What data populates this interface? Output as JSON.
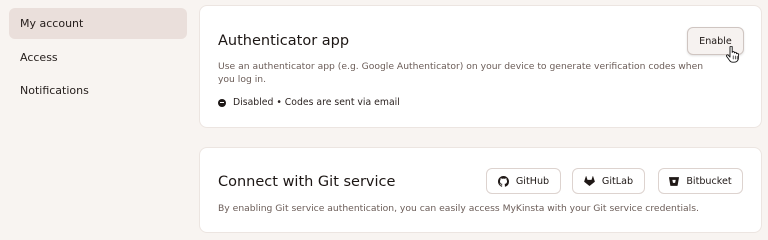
{
  "sidebar": {
    "items": [
      {
        "label": "My account",
        "active": true
      },
      {
        "label": "Access",
        "active": false
      },
      {
        "label": "Notifications",
        "active": false
      }
    ]
  },
  "authenticator": {
    "title": "Authenticator app",
    "description": "Use an authenticator app (e.g. Google Authenticator) on your device to generate verification codes when you log in.",
    "status": "Disabled • Codes are sent via email",
    "enable_label": "Enable"
  },
  "git": {
    "title": "Connect with Git service",
    "description": "By enabling Git service authentication, you can easily access MyKinsta with your Git service credentials.",
    "buttons": [
      {
        "label": "GitHub",
        "icon": "github-icon"
      },
      {
        "label": "GitLab",
        "icon": "gitlab-icon"
      },
      {
        "label": "Bitbucket",
        "icon": "bitbucket-icon"
      }
    ]
  },
  "colors": {
    "page_background": "#f8f4f1",
    "active_nav_background": "#eadfdb",
    "card_background": "#ffffff",
    "text_primary": "#1e1817",
    "text_secondary": "#6b5d58"
  }
}
